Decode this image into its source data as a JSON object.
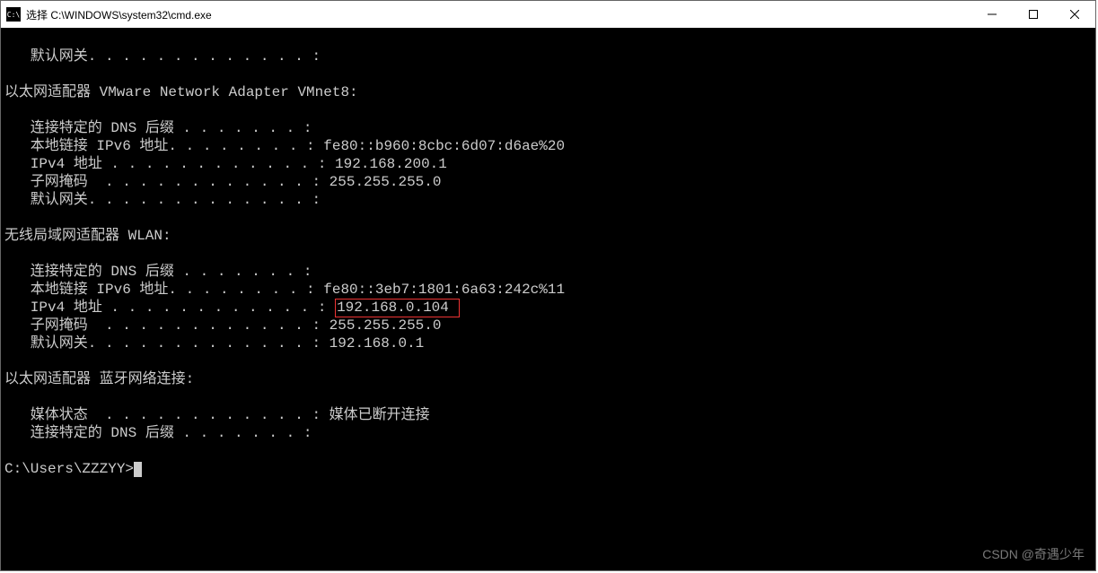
{
  "window": {
    "title": "选择 C:\\WINDOWS\\system32\\cmd.exe",
    "icon_label": "C:\\"
  },
  "term": {
    "top_gateway_label": "   默认网关. . . . . . . . . . . . . : ",
    "adapter1_header": "以太网适配器 VMware Network Adapter VMnet8:",
    "adapter1_dns": "   连接特定的 DNS 后缀 . . . . . . . : ",
    "adapter1_ipv6": "   本地链接 IPv6 地址. . . . . . . . : fe80::b960:8cbc:6d07:d6ae%20",
    "adapter1_ipv4": "   IPv4 地址 . . . . . . . . . . . . : 192.168.200.1",
    "adapter1_mask": "   子网掩码  . . . . . . . . . . . . : 255.255.255.0",
    "adapter1_gw": "   默认网关. . . . . . . . . . . . . : ",
    "adapter2_header": "无线局域网适配器 WLAN:",
    "adapter2_dns": "   连接特定的 DNS 后缀 . . . . . . . : ",
    "adapter2_ipv6": "   本地链接 IPv6 地址. . . . . . . . : fe80::3eb7:1801:6a63:242c%11",
    "adapter2_ipv4_label": "   IPv4 地址 . . . . . . . . . . . . : ",
    "adapter2_ipv4_value": "192.168.0.104 ",
    "adapter2_mask": "   子网掩码  . . . . . . . . . . . . : 255.255.255.0",
    "adapter2_gw": "   默认网关. . . . . . . . . . . . . : 192.168.0.1",
    "adapter3_header": "以太网适配器 蓝牙网络连接:",
    "adapter3_media": "   媒体状态  . . . . . . . . . . . . : 媒体已断开连接",
    "adapter3_dns": "   连接特定的 DNS 后缀 . . . . . . . : ",
    "prompt": "C:\\Users\\ZZZYY>"
  },
  "watermark": "CSDN @奇遇少年"
}
